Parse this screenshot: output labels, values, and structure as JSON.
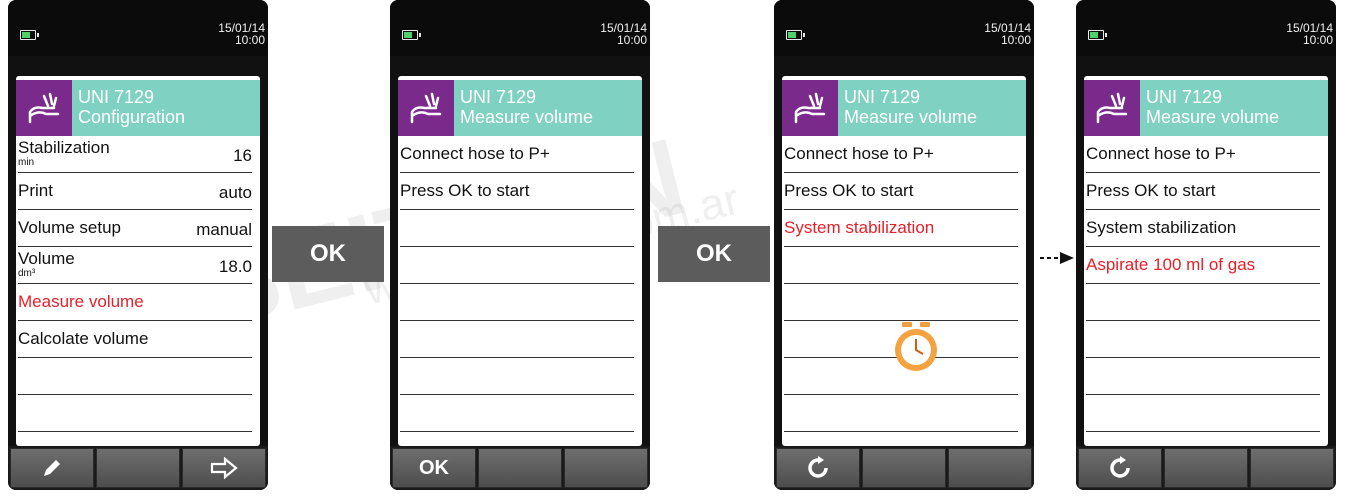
{
  "watermark": {
    "brand": "SEITRON",
    "url": "www.seitron.com.ar"
  },
  "colors": {
    "header_teal": "#7fd1c2",
    "logo_purple": "#7a2a8a",
    "highlight_red": "#e8202a",
    "ok_gray": "#5c5c5c"
  },
  "ok_buttons": [
    "OK",
    "OK"
  ],
  "screens": [
    {
      "date": "15/01/14",
      "time": "10:00",
      "title": "UNI 7129",
      "subtitle": "Configuration",
      "rows": [
        {
          "label": "Stabilization",
          "sub": "min",
          "value": "16"
        },
        {
          "label": "Print",
          "value": "auto"
        },
        {
          "label": "Volume setup",
          "value": "manual"
        },
        {
          "label": "Volume",
          "sub": "dm³",
          "value": "18.0"
        },
        {
          "label": "Measure volume",
          "highlight": true
        },
        {
          "label": "Calcolate volume"
        }
      ],
      "softkeys": [
        "pencil-icon",
        "",
        "arrow-right-icon"
      ]
    },
    {
      "date": "15/01/14",
      "time": "10:00",
      "title": "UNI 7129",
      "subtitle": "Measure volume",
      "rows": [
        {
          "label": "Connect hose to P+"
        },
        {
          "label": "Press OK to start"
        }
      ],
      "softkeys": [
        "OK",
        "",
        ""
      ]
    },
    {
      "date": "15/01/14",
      "time": "10:00",
      "title": "UNI 7129",
      "subtitle": "Measure volume",
      "rows": [
        {
          "label": "Connect hose to P+"
        },
        {
          "label": "Press OK to start"
        },
        {
          "label": "System stabilization",
          "highlight": true
        }
      ],
      "status_icon": "stopwatch-icon",
      "softkeys": [
        "refresh-icon",
        "",
        ""
      ]
    },
    {
      "date": "15/01/14",
      "time": "10:00",
      "title": "UNI 7129",
      "subtitle": "Measure volume",
      "rows": [
        {
          "label": "Connect hose to P+"
        },
        {
          "label": "Press OK to start"
        },
        {
          "label": "System stabilization"
        },
        {
          "label": "Aspirate 100 ml of gas",
          "highlight": true
        }
      ],
      "softkeys": [
        "refresh-icon",
        "",
        ""
      ]
    }
  ]
}
